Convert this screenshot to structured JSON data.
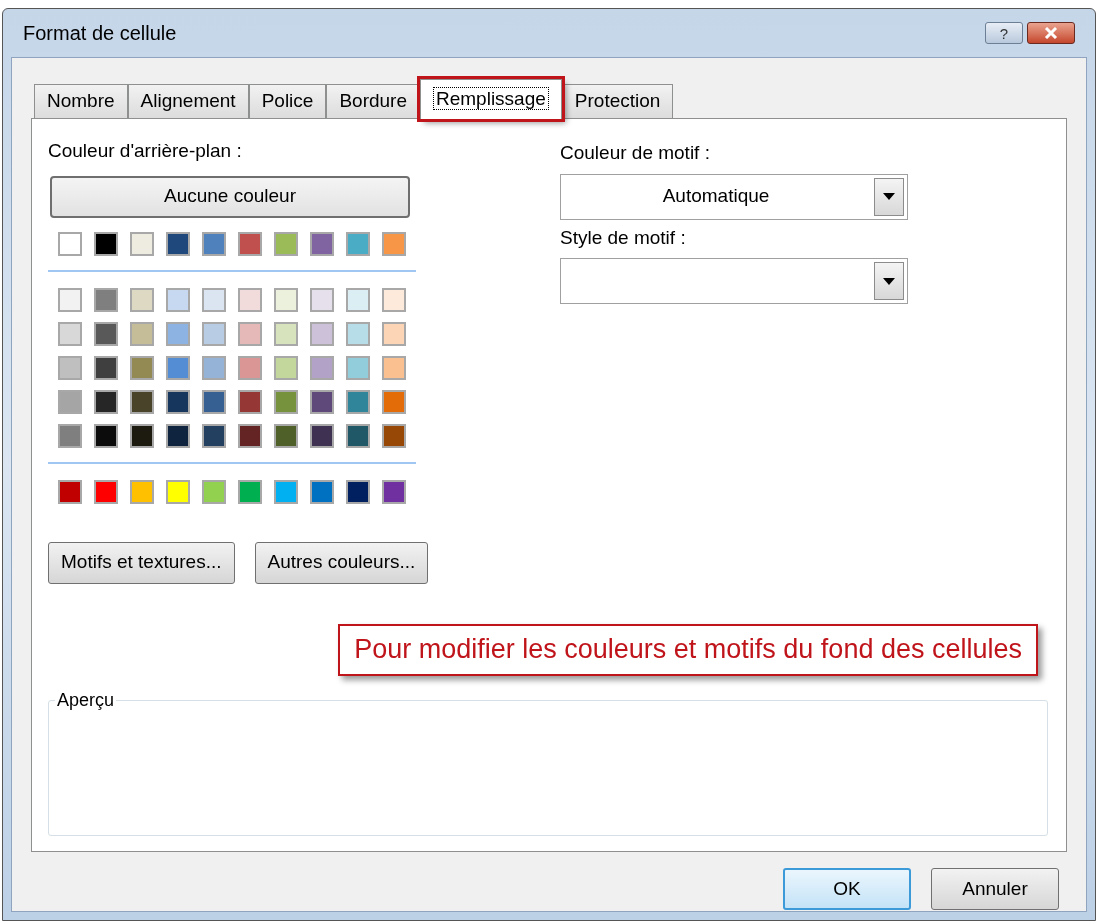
{
  "window": {
    "title": "Format de cellule",
    "help": "?"
  },
  "tabs": [
    {
      "label": "Nombre",
      "selected": false,
      "highlighted": false
    },
    {
      "label": "Alignement",
      "selected": false,
      "highlighted": false
    },
    {
      "label": "Police",
      "selected": false,
      "highlighted": false
    },
    {
      "label": "Bordure",
      "selected": false,
      "highlighted": false
    },
    {
      "label": "Remplissage",
      "selected": true,
      "highlighted": true
    },
    {
      "label": "Protection",
      "selected": false,
      "highlighted": false
    }
  ],
  "background_color": {
    "label": "Couleur d'arrière-plan :",
    "no_color_button": "Aucune couleur",
    "theme_row": [
      {
        "color": "#ffffff"
      },
      {
        "color": "#000000"
      },
      {
        "color": "#eeece1"
      },
      {
        "color": "#1f497d"
      },
      {
        "color": "#4f81bd"
      },
      {
        "color": "#c0504d"
      },
      {
        "color": "#9bbb59"
      },
      {
        "color": "#8064a2"
      },
      {
        "color": "#4bacc6"
      },
      {
        "color": "#f79646"
      }
    ],
    "shade_rows": [
      [
        {
          "color": "#f2f2f2"
        },
        {
          "color": "#7f7f7f"
        },
        {
          "color": "#ddd9c3"
        },
        {
          "color": "#c6d9f0"
        },
        {
          "color": "#dbe5f1"
        },
        {
          "color": "#f2dcdb"
        },
        {
          "color": "#ebf1dd"
        },
        {
          "color": "#e5e0ec"
        },
        {
          "color": "#dbeef3"
        },
        {
          "color": "#fdeada"
        }
      ],
      [
        {
          "color": "#d8d8d8"
        },
        {
          "color": "#595959"
        },
        {
          "color": "#c4bd97"
        },
        {
          "color": "#8db3e2"
        },
        {
          "color": "#b8cce4"
        },
        {
          "color": "#e5b9b7"
        },
        {
          "color": "#d7e3bc"
        },
        {
          "color": "#ccc1d9"
        },
        {
          "color": "#b7dde8"
        },
        {
          "color": "#fbd5b5"
        }
      ],
      [
        {
          "color": "#bfbfbf"
        },
        {
          "color": "#3f3f3f"
        },
        {
          "color": "#938953"
        },
        {
          "color": "#548dd4"
        },
        {
          "color": "#95b3d7"
        },
        {
          "color": "#d99694"
        },
        {
          "color": "#c3d69b"
        },
        {
          "color": "#b2a2c7"
        },
        {
          "color": "#92cddc"
        },
        {
          "color": "#fac08f"
        }
      ],
      [
        {
          "color": "#a5a5a5"
        },
        {
          "color": "#262626"
        },
        {
          "color": "#494429"
        },
        {
          "color": "#17365d"
        },
        {
          "color": "#366092"
        },
        {
          "color": "#953734"
        },
        {
          "color": "#76923c"
        },
        {
          "color": "#5f497a"
        },
        {
          "color": "#31859b"
        },
        {
          "color": "#e36c09"
        }
      ],
      [
        {
          "color": "#7f7f7f"
        },
        {
          "color": "#0c0c0c"
        },
        {
          "color": "#1d1b10"
        },
        {
          "color": "#0f243e"
        },
        {
          "color": "#244061"
        },
        {
          "color": "#632423"
        },
        {
          "color": "#4f6128"
        },
        {
          "color": "#3f3151"
        },
        {
          "color": "#205867"
        },
        {
          "color": "#974806"
        }
      ]
    ],
    "standard_row": [
      {
        "color": "#c00000"
      },
      {
        "color": "#ff0000"
      },
      {
        "color": "#ffc000"
      },
      {
        "color": "#ffff00"
      },
      {
        "color": "#92d050"
      },
      {
        "color": "#00b050"
      },
      {
        "color": "#00b0f0"
      },
      {
        "color": "#0070c0"
      },
      {
        "color": "#002060"
      },
      {
        "color": "#7030a0"
      }
    ],
    "buttons": [
      "Motifs et textures...",
      "Autres couleurs..."
    ]
  },
  "pattern_color": {
    "label": "Couleur de motif :",
    "value": "Automatique"
  },
  "pattern_style": {
    "label": "Style de motif :"
  },
  "callout": "Pour modifier les couleurs et motifs du fond des cellules",
  "preview": {
    "label": "Aperçu"
  },
  "footer_buttons": [
    {
      "label": "OK",
      "default": true
    },
    {
      "label": "Annuler",
      "default": false
    }
  ]
}
